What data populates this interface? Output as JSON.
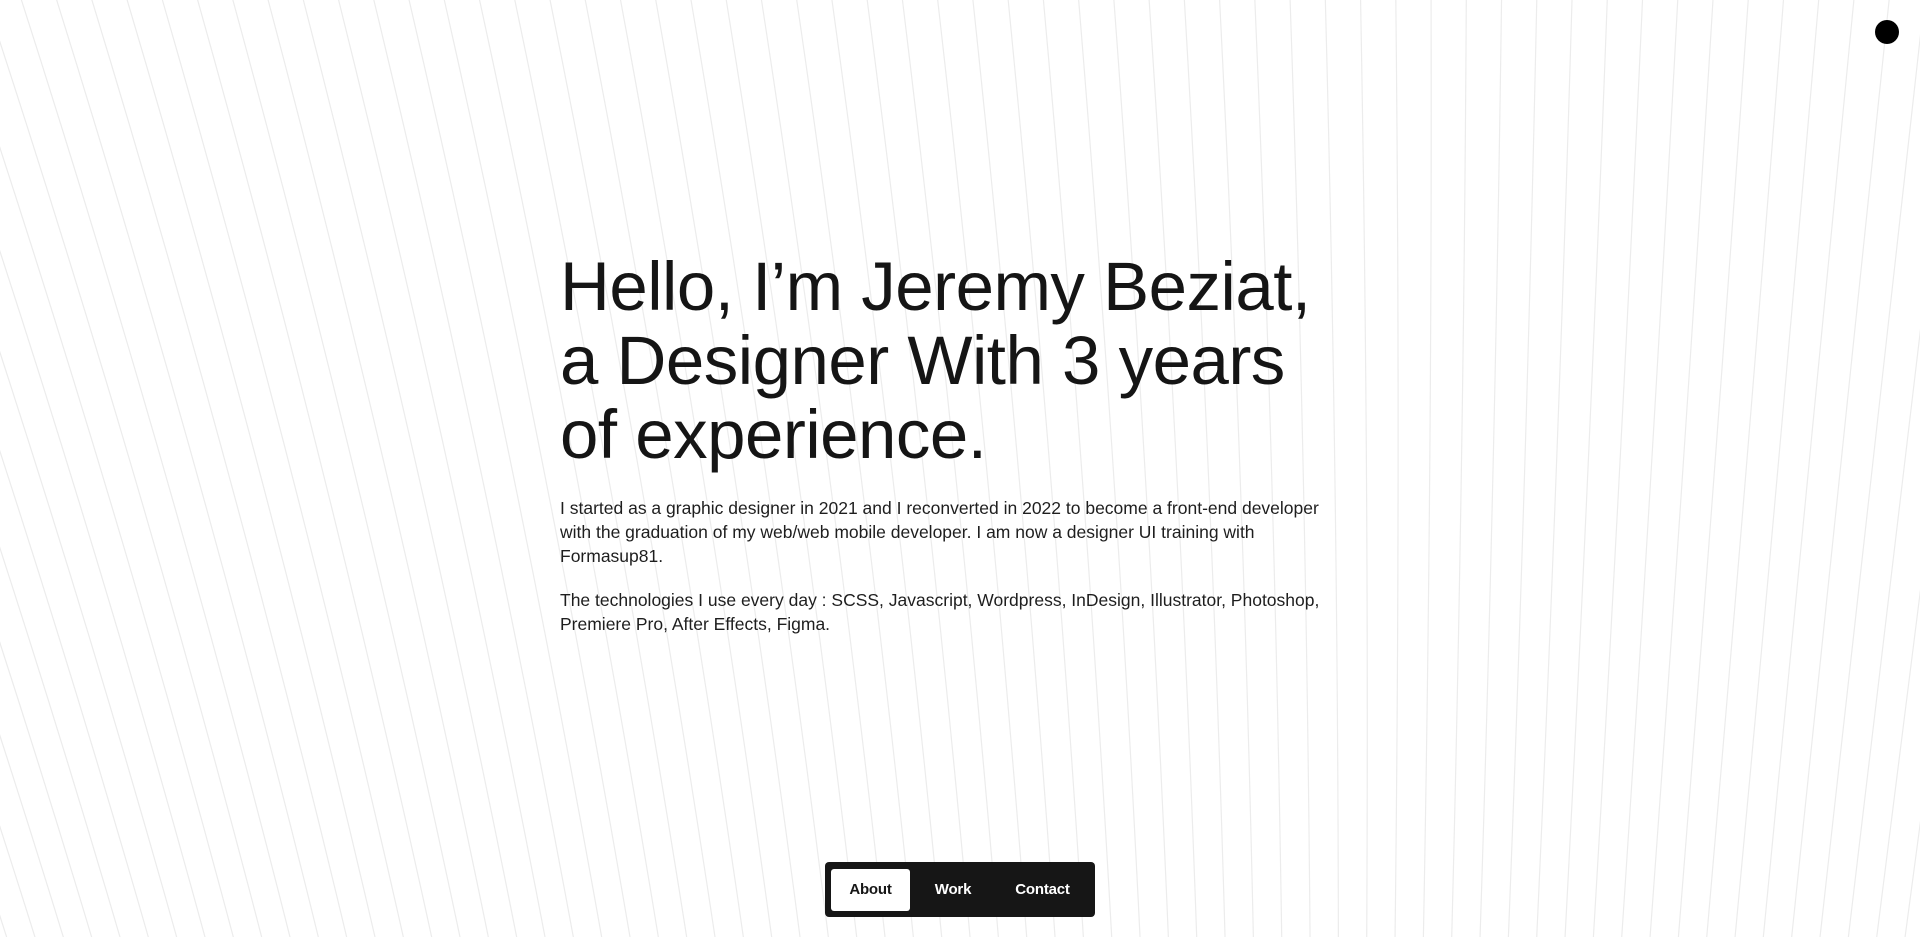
{
  "hero": {
    "headline_lines": [
      "Hello, I’m Jeremy Beziat,",
      "a Designer With 3 years",
      "of experience."
    ],
    "paragraphs": [
      "I started as a graphic designer in 2021 and I reconverted in 2022 to become a front-end developer with the graduation of my web/web mobile developer. I am now a designer UI training with Formasup81.",
      "The technologies I use every day : SCSS, Javascript, Wordpress, InDesign, Illustrator, Photoshop, Premiere Pro, After Effects, Figma."
    ]
  },
  "nav": {
    "items": [
      {
        "label": "About",
        "active": true
      },
      {
        "label": "Work",
        "active": false
      },
      {
        "label": "Contact",
        "active": false
      }
    ]
  },
  "colors": {
    "background": "#ffffff",
    "text": "#151515",
    "nav_background": "#161616",
    "nav_active_background": "#ffffff",
    "line_pattern": "#ececec",
    "cursor_dot": "#000000"
  },
  "icons": {
    "cursor": "cursor-dot-icon"
  }
}
